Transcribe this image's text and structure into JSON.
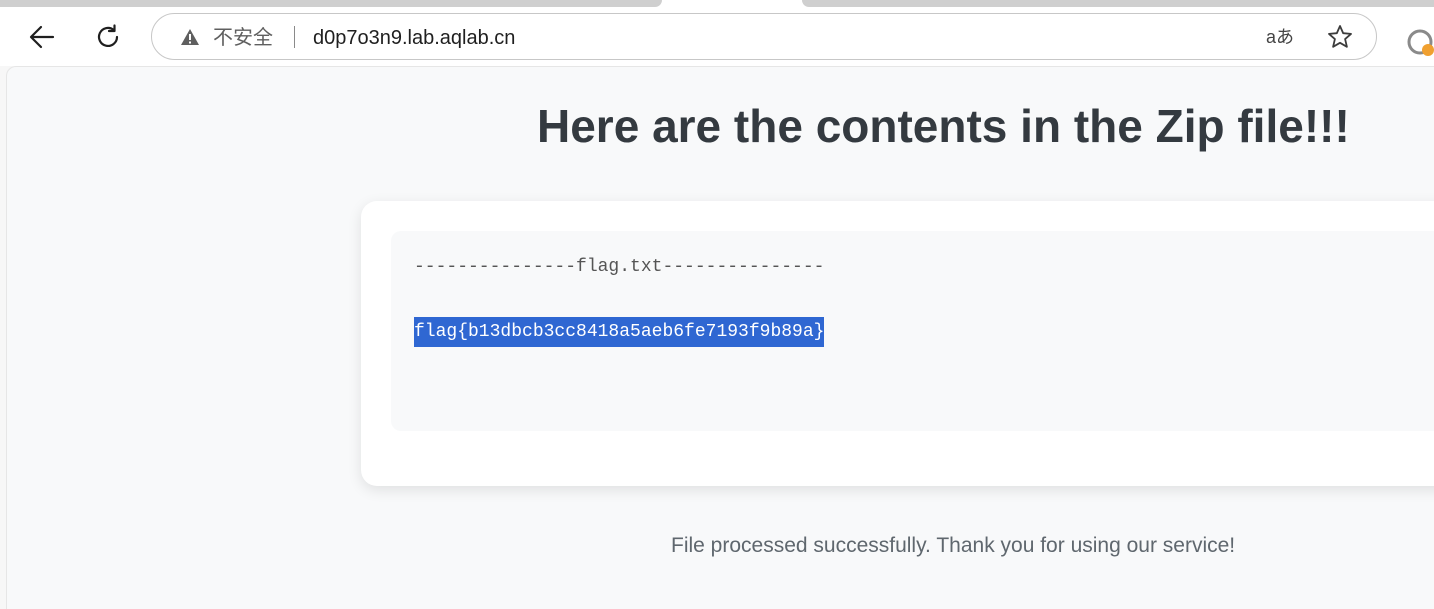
{
  "browser": {
    "security_label": "不安全",
    "url": "d0p7o3n9.lab.aqlab.cn",
    "translate_glyph": "aあ"
  },
  "page": {
    "title": "Here are the contents in the Zip file!!!",
    "file_header": "---------------flag.txt---------------",
    "file_content": "flag{b13dbcb3cc8418a5aeb6fe7193f9b89a}",
    "status_message": "File processed successfully. Thank you for using our service!"
  },
  "colors": {
    "selection": "#2f67d2",
    "title": "#343a40",
    "page_bg": "#f8f9fa"
  },
  "icons": [
    "back-arrow-icon",
    "reload-icon",
    "warning-icon",
    "translate-icon",
    "star-icon",
    "profile-icon"
  ]
}
